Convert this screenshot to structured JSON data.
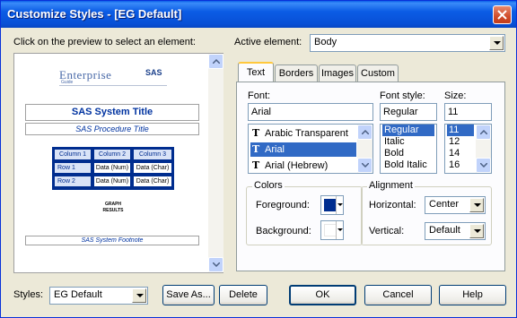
{
  "window": {
    "title": "Customize Styles - [EG Default]"
  },
  "left": {
    "instruction": "Click on the preview to select an element:"
  },
  "preview": {
    "logo_text": "Enterprise",
    "logo_sub": "Guide",
    "sas_logo": "SAS",
    "system_title": "SAS System Title",
    "procedure_title": "SAS Procedure Title",
    "table": {
      "headers": [
        "Column 1",
        "Column 2",
        "Column 3"
      ],
      "rows": [
        {
          "label": "Row 1",
          "cells": [
            "Data (Num)",
            "Data (Char)"
          ]
        },
        {
          "label": "Row 2",
          "cells": [
            "Data (Num)",
            "Data (Char)"
          ]
        }
      ]
    },
    "graph_results": [
      "GRAPH",
      "RESULTS"
    ],
    "system_footnote": "SAS System Footnote"
  },
  "active_element": {
    "label": "Active element:",
    "value": "Body"
  },
  "tabs": [
    {
      "label": "Text",
      "active": true
    },
    {
      "label": "Borders",
      "active": false
    },
    {
      "label": "Images",
      "active": false
    },
    {
      "label": "Custom",
      "active": false
    }
  ],
  "font": {
    "label": "Font:",
    "value": "Arial",
    "items": [
      "Arabic Transparent",
      "Arial",
      "Arial (Hebrew)"
    ],
    "selected": "Arial"
  },
  "font_style": {
    "label": "Font style:",
    "value": "Regular",
    "items": [
      "Regular",
      "Italic",
      "Bold",
      "Bold Italic"
    ],
    "selected": "Regular"
  },
  "size": {
    "label": "Size:",
    "value": "11",
    "items": [
      "11",
      "12",
      "14",
      "16"
    ],
    "selected": "11"
  },
  "colors": {
    "title": "Colors",
    "foreground_label": "Foreground:",
    "background_label": "Background:",
    "foreground_color": "#002d8f",
    "background_color": "#ffffff"
  },
  "alignment": {
    "title": "Alignment",
    "horizontal_label": "Horizontal:",
    "horizontal_value": "Center",
    "vertical_label": "Vertical:",
    "vertical_value": "Default"
  },
  "footer": {
    "styles_label": "Styles:",
    "styles_value": "EG Default",
    "save_as": "Save As...",
    "delete": "Delete",
    "ok": "OK",
    "cancel": "Cancel",
    "help": "Help"
  }
}
